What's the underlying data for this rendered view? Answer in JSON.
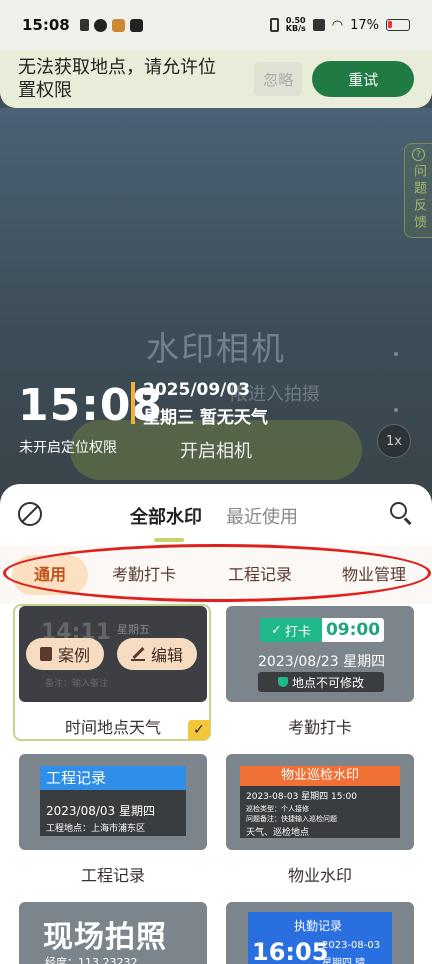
{
  "status_bar": {
    "time": "15:08",
    "net_speed_value": "0.50",
    "net_speed_unit": "KB/s",
    "battery": "17%"
  },
  "location_banner": {
    "message": "无法获取地点，请允许位置权限",
    "ignore_label": "忽略",
    "retry_label": "重试"
  },
  "camera": {
    "feedback_label": "问题反馈",
    "title": "水印相机",
    "hint_text": "限进入拍摄",
    "open_camera_label": "开启相机",
    "zoom_label": "1x"
  },
  "overlay": {
    "time": "15:08",
    "date": "2025/09/03",
    "weekday_weather": "星期三 暂无天气",
    "location_permission": "未开启定位权限"
  },
  "sheet": {
    "tabs": [
      "全部水印",
      "最近使用"
    ],
    "categories": [
      "通用",
      "考勤打卡",
      "工程记录",
      "物业管理"
    ],
    "cards": [
      {
        "label": "时间地点天气",
        "preview_time": "14:11",
        "preview_weekday": "星期五",
        "preview_note": "备注：输入备注",
        "buttons": [
          "案例",
          "编辑"
        ]
      },
      {
        "label": "考勤打卡",
        "punch_label": "打卡",
        "punch_time": "09:00",
        "date": "2023/08/23 星期四",
        "lock_note": "地点不可修改"
      },
      {
        "label": "工程记录",
        "header": "工程记录",
        "date": "2023/08/03 星期四",
        "location": "工程地点：上海市浦东区"
      },
      {
        "label": "物业水印",
        "header": "物业巡检水印",
        "datetime": "2023-08-03 星期四 15:00",
        "line1": "巡检类型：个人接修",
        "line2": "问题备注：快捷输入巡检问题",
        "line3": "天气、巡检地点"
      },
      {
        "label": "",
        "big_title": "现场拍照",
        "coord": "经度：113.23232"
      },
      {
        "label": "",
        "header": "执勤记录",
        "time": "16:05",
        "date": "2023-08-03",
        "weekday": "星期四 晴"
      }
    ]
  }
}
